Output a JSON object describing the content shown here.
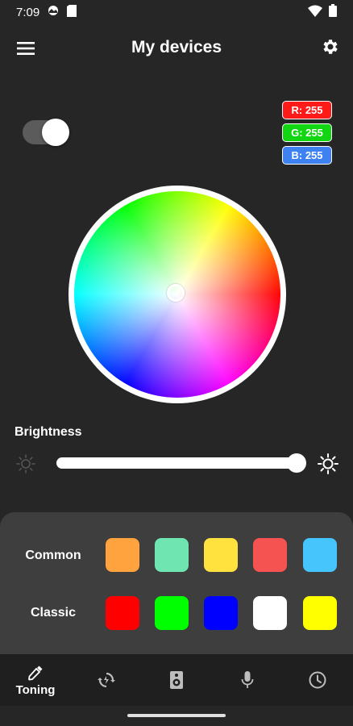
{
  "status_bar": {
    "time": "7:09",
    "icons": [
      "photo-notification-icon",
      "sim-card-icon",
      "wifi-icon",
      "battery-icon"
    ]
  },
  "app_bar": {
    "title": "My devices",
    "menu_icon": "hamburger-menu-icon",
    "settings_icon": "gear-icon"
  },
  "power_toggle": {
    "on": true
  },
  "rgb": {
    "r_label": "R: 255",
    "g_label": "G: 255",
    "b_label": "B: 255",
    "colors": {
      "r": "#ff1a1a",
      "g": "#12d612",
      "b": "#3d82f0"
    }
  },
  "color_wheel": {
    "selected_color": "#ffffff"
  },
  "brightness": {
    "label": "Brightness",
    "value": 1.0,
    "min_icon": "sun-dim-icon",
    "max_icon": "sun-bright-icon"
  },
  "presets": {
    "common_label": "Common",
    "classic_label": "Classic",
    "common_colors": [
      "#ffa33f",
      "#6fe6b2",
      "#ffe23d",
      "#f55252",
      "#46c5fc"
    ],
    "classic_colors": [
      "#ff0000",
      "#00ff00",
      "#0000ff",
      "#ffffff",
      "#ffff00"
    ]
  },
  "bottom_nav": {
    "items": [
      {
        "icon": "eyedropper-icon",
        "label": "Toning",
        "active": true
      },
      {
        "icon": "color-cycle-icon",
        "label": "",
        "active": false
      },
      {
        "icon": "speaker-icon",
        "label": "",
        "active": false
      },
      {
        "icon": "microphone-icon",
        "label": "",
        "active": false
      },
      {
        "icon": "clock-icon",
        "label": "",
        "active": false
      }
    ]
  },
  "theme": {
    "background": "#262626",
    "panel": "#3e3e3e",
    "nav": "#1f1f1f"
  }
}
